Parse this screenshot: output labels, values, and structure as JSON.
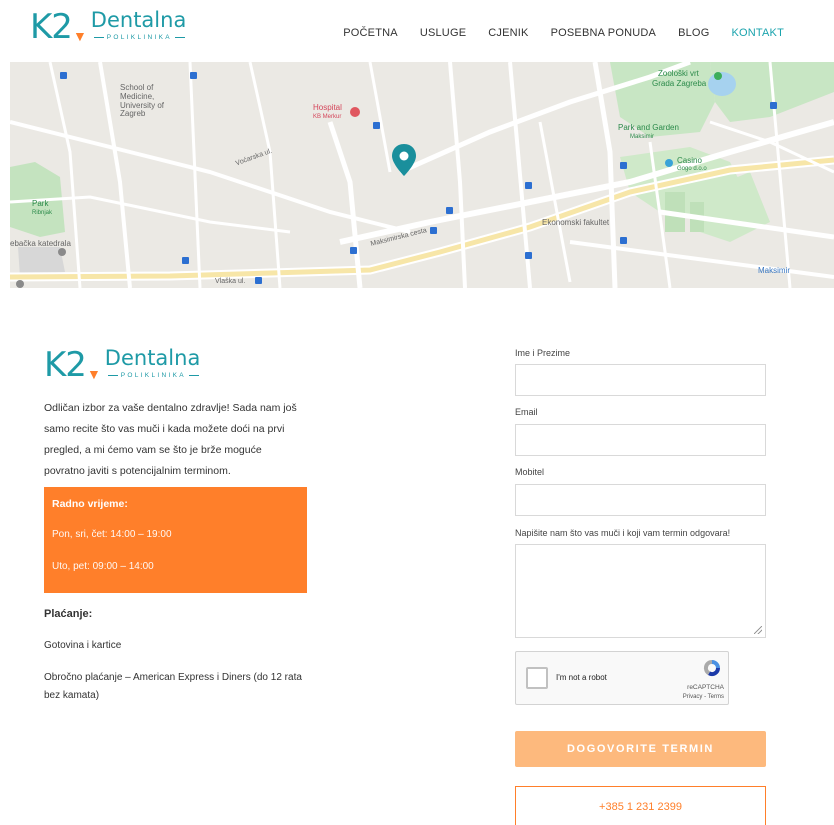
{
  "brand": {
    "mark": "K2",
    "name": "Dentalna",
    "sub": "POLIKLINIKA",
    "primary_color": "#1e9aa6",
    "accent_color": "#ff7f2a"
  },
  "nav": {
    "items": [
      {
        "label": "POČETNA"
      },
      {
        "label": "USLUGE"
      },
      {
        "label": "CJENIK"
      },
      {
        "label": "POSEBNA PONUDA"
      },
      {
        "label": "BLOG"
      },
      {
        "label": "KONTAKT",
        "active": true
      }
    ]
  },
  "map": {
    "labels": {
      "school": "School of Medicine, University of Zagreb",
      "hospital": "Hospital",
      "hospital_sub": "KB Merkur",
      "zoo": "Zoološki vrt",
      "zoo_sub": "Grada Zagreba",
      "park_garden": "Park and Garden",
      "park_garden_sub": "Maksimir",
      "casino": "Casino",
      "casino_sub": "Gogo d.o.o",
      "park": "Park",
      "park_sub": "Ribnjak",
      "ekonomski": "Ekonomski fakultet",
      "maksimirska": "Maksimirska cesta",
      "vocarska": "Voćarska ul.",
      "katedrala": "ebačka katedrala",
      "vlaska": "Vlaška ul.",
      "maksimir": "Maksimir"
    }
  },
  "left": {
    "intro": "Odličan izbor za vaše dentalno zdravlje! Sada nam još samo recite što vas muči i kada možete doći na prvi pregled, a mi ćemo vam se što je brže moguće povratno javiti s potencijalnim terminom.",
    "hours": {
      "title": "Radno vrijeme:",
      "line1": "Pon, sri, čet: 14:00 – 19:00",
      "line2": "Uto, pet: 09:00 – 14:00"
    },
    "payment": {
      "title": "Plaćanje:",
      "line1": "Gotovina i kartice",
      "line2": "Obročno plaćanje – American Express i Diners (do 12 rata bez kamata)"
    }
  },
  "form": {
    "name_label": "Ime i Prezime",
    "email_label": "Email",
    "phone_label": "Mobitel",
    "message_label": "Napišite nam što vas muči i koji vam termin odgovara!",
    "captcha": {
      "label": "I'm not a robot",
      "brand": "reCAPTCHA",
      "terms": "Privacy - Terms"
    },
    "submit_label": "DOGOVORITE TERMIN",
    "phone_button": "+385 1 231 2399"
  }
}
